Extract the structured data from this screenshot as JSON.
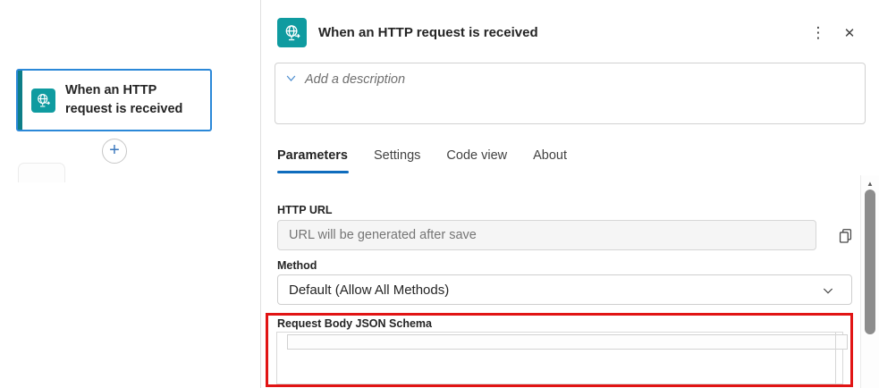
{
  "canvas": {
    "trigger_card": {
      "title": "When an HTTP request is received"
    },
    "add_label": "+"
  },
  "panel": {
    "header": {
      "title": "When an HTTP request is received"
    },
    "icons": {
      "more": "⋮",
      "close": "✕",
      "scroll_up": "▲"
    },
    "description_placeholder": "Add a description",
    "tabs": [
      {
        "label": "Parameters",
        "active": true
      },
      {
        "label": "Settings",
        "active": false
      },
      {
        "label": "Code view",
        "active": false
      },
      {
        "label": "About",
        "active": false
      }
    ],
    "fields": {
      "http_url_label": "HTTP URL",
      "http_url_placeholder": "URL will be generated after save",
      "method_label": "Method",
      "method_value": "Default (Allow All Methods)",
      "schema_label": "Request Body JSON Schema",
      "schema_value": ""
    }
  },
  "colors": {
    "connector_teal": "#0f9ba0",
    "selection_blue": "#2b88d8",
    "accent_blue": "#0f6cbd",
    "highlight_red": "#e11414"
  }
}
